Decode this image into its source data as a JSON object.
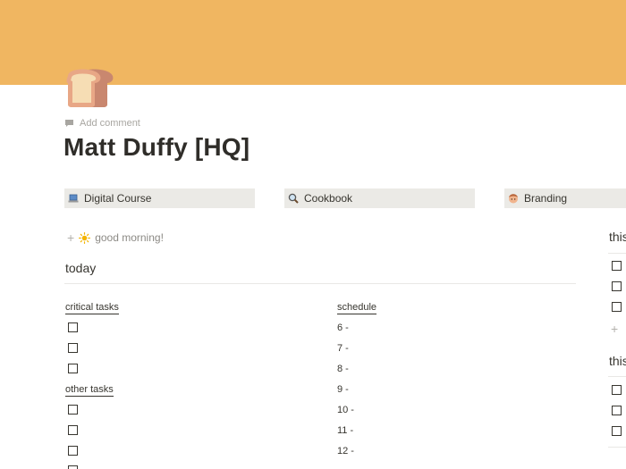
{
  "colors": {
    "cover": "#f0b661",
    "card_bg": "#ebeae6",
    "text": "#37352f"
  },
  "page_icon": "bread-slice-icon",
  "comment": {
    "label": "Add comment",
    "icon": "comment-icon"
  },
  "title": "Matt Duffy [HQ]",
  "link_cards": [
    {
      "label": "Digital Course",
      "icon": "laptop-icon"
    },
    {
      "label": "Cookbook",
      "icon": "magnifier-icon"
    },
    {
      "label": "Branding",
      "icon": "face-icon"
    }
  ],
  "greeting": {
    "plus": "+",
    "icon": "sun-icon",
    "text": "good morning!"
  },
  "today": {
    "heading": "today",
    "critical_tasks_label": "critical tasks",
    "other_tasks_label": "other tasks",
    "schedule_label": "schedule",
    "schedule": [
      "6 -",
      "7 -",
      "8 -",
      "9 -",
      "10 -",
      "11 -",
      "12 -"
    ]
  },
  "right_sections": [
    {
      "heading": "this"
    },
    {
      "heading": "this"
    }
  ],
  "right_add": "+"
}
